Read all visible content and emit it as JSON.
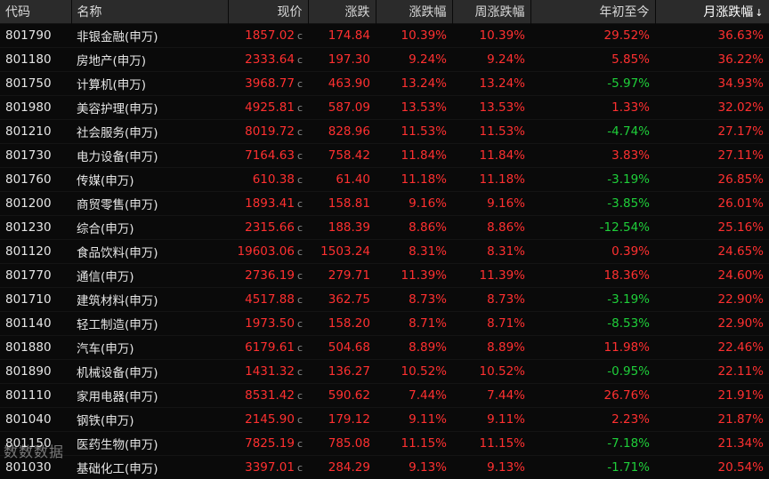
{
  "header": {
    "code": "代码",
    "name": "名称",
    "price": "现价",
    "change": "涨跌",
    "change_pct": "涨跌幅",
    "week_pct": "周涨跌幅",
    "ytd_pct": "年初至今",
    "month_pct": "月涨跌幅",
    "sort_icon": "down-arrow"
  },
  "price_suffix": "c",
  "colors": {
    "up": "#ff3030",
    "down": "#1fcf3a",
    "header_bg": "#2b2b2b",
    "bg": "#0a0a0a"
  },
  "rows": [
    {
      "code": "801790",
      "name": "非银金融(申万)",
      "price": "1857.02",
      "change": "174.84",
      "change_pct": "10.39%",
      "week_pct": "10.39%",
      "ytd_pct": "29.52%",
      "ytd_dir": "up",
      "month_pct": "36.63%"
    },
    {
      "code": "801180",
      "name": "房地产(申万)",
      "price": "2333.64",
      "change": "197.30",
      "change_pct": "9.24%",
      "week_pct": "9.24%",
      "ytd_pct": "5.85%",
      "ytd_dir": "up",
      "month_pct": "36.22%"
    },
    {
      "code": "801750",
      "name": "计算机(申万)",
      "price": "3968.77",
      "change": "463.90",
      "change_pct": "13.24%",
      "week_pct": "13.24%",
      "ytd_pct": "-5.97%",
      "ytd_dir": "down",
      "month_pct": "34.93%"
    },
    {
      "code": "801980",
      "name": "美容护理(申万)",
      "price": "4925.81",
      "change": "587.09",
      "change_pct": "13.53%",
      "week_pct": "13.53%",
      "ytd_pct": "1.33%",
      "ytd_dir": "up",
      "month_pct": "32.02%"
    },
    {
      "code": "801210",
      "name": "社会服务(申万)",
      "price": "8019.72",
      "change": "828.96",
      "change_pct": "11.53%",
      "week_pct": "11.53%",
      "ytd_pct": "-4.74%",
      "ytd_dir": "down",
      "month_pct": "27.17%"
    },
    {
      "code": "801730",
      "name": "电力设备(申万)",
      "price": "7164.63",
      "change": "758.42",
      "change_pct": "11.84%",
      "week_pct": "11.84%",
      "ytd_pct": "3.83%",
      "ytd_dir": "up",
      "month_pct": "27.11%"
    },
    {
      "code": "801760",
      "name": "传媒(申万)",
      "price": "610.38",
      "change": "61.40",
      "change_pct": "11.18%",
      "week_pct": "11.18%",
      "ytd_pct": "-3.19%",
      "ytd_dir": "down",
      "month_pct": "26.85%"
    },
    {
      "code": "801200",
      "name": "商贸零售(申万)",
      "price": "1893.41",
      "change": "158.81",
      "change_pct": "9.16%",
      "week_pct": "9.16%",
      "ytd_pct": "-3.85%",
      "ytd_dir": "down",
      "month_pct": "26.01%"
    },
    {
      "code": "801230",
      "name": "综合(申万)",
      "price": "2315.66",
      "change": "188.39",
      "change_pct": "8.86%",
      "week_pct": "8.86%",
      "ytd_pct": "-12.54%",
      "ytd_dir": "down",
      "month_pct": "25.16%"
    },
    {
      "code": "801120",
      "name": "食品饮料(申万)",
      "price": "19603.06",
      "change": "1503.24",
      "change_pct": "8.31%",
      "week_pct": "8.31%",
      "ytd_pct": "0.39%",
      "ytd_dir": "up",
      "month_pct": "24.65%"
    },
    {
      "code": "801770",
      "name": "通信(申万)",
      "price": "2736.19",
      "change": "279.71",
      "change_pct": "11.39%",
      "week_pct": "11.39%",
      "ytd_pct": "18.36%",
      "ytd_dir": "up",
      "month_pct": "24.60%"
    },
    {
      "code": "801710",
      "name": "建筑材料(申万)",
      "price": "4517.88",
      "change": "362.75",
      "change_pct": "8.73%",
      "week_pct": "8.73%",
      "ytd_pct": "-3.19%",
      "ytd_dir": "down",
      "month_pct": "22.90%"
    },
    {
      "code": "801140",
      "name": "轻工制造(申万)",
      "price": "1973.50",
      "change": "158.20",
      "change_pct": "8.71%",
      "week_pct": "8.71%",
      "ytd_pct": "-8.53%",
      "ytd_dir": "down",
      "month_pct": "22.90%"
    },
    {
      "code": "801880",
      "name": "汽车(申万)",
      "price": "6179.61",
      "change": "504.68",
      "change_pct": "8.89%",
      "week_pct": "8.89%",
      "ytd_pct": "11.98%",
      "ytd_dir": "up",
      "month_pct": "22.46%"
    },
    {
      "code": "801890",
      "name": "机械设备(申万)",
      "price": "1431.32",
      "change": "136.27",
      "change_pct": "10.52%",
      "week_pct": "10.52%",
      "ytd_pct": "-0.95%",
      "ytd_dir": "down",
      "month_pct": "22.11%"
    },
    {
      "code": "801110",
      "name": "家用电器(申万)",
      "price": "8531.42",
      "change": "590.62",
      "change_pct": "7.44%",
      "week_pct": "7.44%",
      "ytd_pct": "26.76%",
      "ytd_dir": "up",
      "month_pct": "21.91%"
    },
    {
      "code": "801040",
      "name": "钢铁(申万)",
      "price": "2145.90",
      "change": "179.12",
      "change_pct": "9.11%",
      "week_pct": "9.11%",
      "ytd_pct": "2.23%",
      "ytd_dir": "up",
      "month_pct": "21.87%"
    },
    {
      "code": "801150",
      "name": "医药生物(申万)",
      "price": "7825.19",
      "change": "785.08",
      "change_pct": "11.15%",
      "week_pct": "11.15%",
      "ytd_pct": "-7.18%",
      "ytd_dir": "down",
      "month_pct": "21.34%"
    },
    {
      "code": "801030",
      "name": "基础化工(申万)",
      "price": "3397.01",
      "change": "284.29",
      "change_pct": "9.13%",
      "week_pct": "9.13%",
      "ytd_pct": "-1.71%",
      "ytd_dir": "down",
      "month_pct": "20.54%"
    }
  ],
  "watermark": "数数数据"
}
